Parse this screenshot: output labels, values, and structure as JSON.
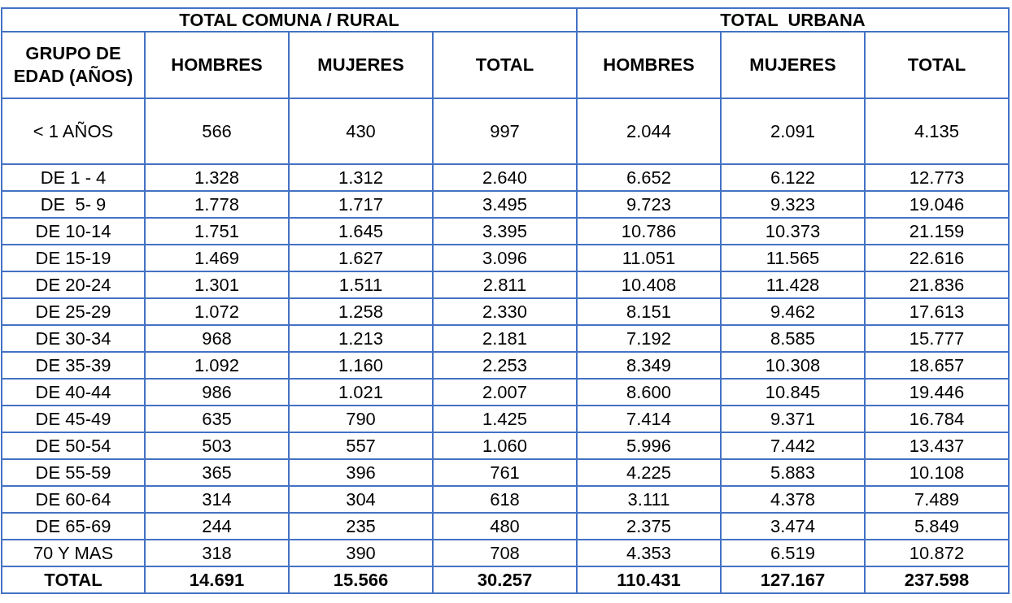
{
  "table": {
    "groups": [
      {
        "label": "TOTAL COMUNA / RURAL"
      },
      {
        "label": "TOTAL  URBANA"
      }
    ],
    "columns": [
      "GRUPO DE EDAD (AÑOS)",
      "HOMBRES",
      "MUJERES",
      "TOTAL",
      "HOMBRES",
      "MUJERES",
      "TOTAL"
    ],
    "rows": [
      {
        "kind": "tall",
        "cells": [
          "< 1 AÑOS",
          "566",
          "430",
          "997",
          "2.044",
          "2.091",
          "4.135"
        ]
      },
      {
        "kind": "data",
        "cells": [
          "DE 1 - 4",
          "1.328",
          "1.312",
          "2.640",
          "6.652",
          "6.122",
          "12.773"
        ]
      },
      {
        "kind": "data",
        "cells": [
          "DE  5- 9",
          "1.778",
          "1.717",
          "3.495",
          "9.723",
          "9.323",
          "19.046"
        ]
      },
      {
        "kind": "data",
        "cells": [
          "DE 10-14",
          "1.751",
          "1.645",
          "3.395",
          "10.786",
          "10.373",
          "21.159"
        ]
      },
      {
        "kind": "data",
        "cells": [
          "DE 15-19",
          "1.469",
          "1.627",
          "3.096",
          "11.051",
          "11.565",
          "22.616"
        ]
      },
      {
        "kind": "data",
        "cells": [
          "DE 20-24",
          "1.301",
          "1.511",
          "2.811",
          "10.408",
          "11.428",
          "21.836"
        ]
      },
      {
        "kind": "data",
        "cells": [
          "DE 25-29",
          "1.072",
          "1.258",
          "2.330",
          "8.151",
          "9.462",
          "17.613"
        ]
      },
      {
        "kind": "data",
        "cells": [
          "DE 30-34",
          "968",
          "1.213",
          "2.181",
          "7.192",
          "8.585",
          "15.777"
        ]
      },
      {
        "kind": "data",
        "cells": [
          "DE 35-39",
          "1.092",
          "1.160",
          "2.253",
          "8.349",
          "10.308",
          "18.657"
        ]
      },
      {
        "kind": "data",
        "cells": [
          "DE 40-44",
          "986",
          "1.021",
          "2.007",
          "8.600",
          "10.845",
          "19.446"
        ]
      },
      {
        "kind": "data",
        "cells": [
          "DE 45-49",
          "635",
          "790",
          "1.425",
          "7.414",
          "9.371",
          "16.784"
        ]
      },
      {
        "kind": "data",
        "cells": [
          "DE 50-54",
          "503",
          "557",
          "1.060",
          "5.996",
          "7.442",
          "13.437"
        ]
      },
      {
        "kind": "data",
        "cells": [
          "DE 55-59",
          "365",
          "396",
          "761",
          "4.225",
          "5.883",
          "10.108"
        ]
      },
      {
        "kind": "data",
        "cells": [
          "DE 60-64",
          "314",
          "304",
          "618",
          "3.111",
          "4.378",
          "7.489"
        ]
      },
      {
        "kind": "data",
        "cells": [
          "DE 65-69",
          "244",
          "235",
          "480",
          "2.375",
          "3.474",
          "5.849"
        ]
      },
      {
        "kind": "data",
        "cells": [
          "70 Y MAS",
          "318",
          "390",
          "708",
          "4.353",
          "6.519",
          "10.872"
        ]
      },
      {
        "kind": "total",
        "cells": [
          "TOTAL",
          "14.691",
          "15.566",
          "30.257",
          "110.431",
          "127.167",
          "237.598"
        ]
      }
    ]
  }
}
